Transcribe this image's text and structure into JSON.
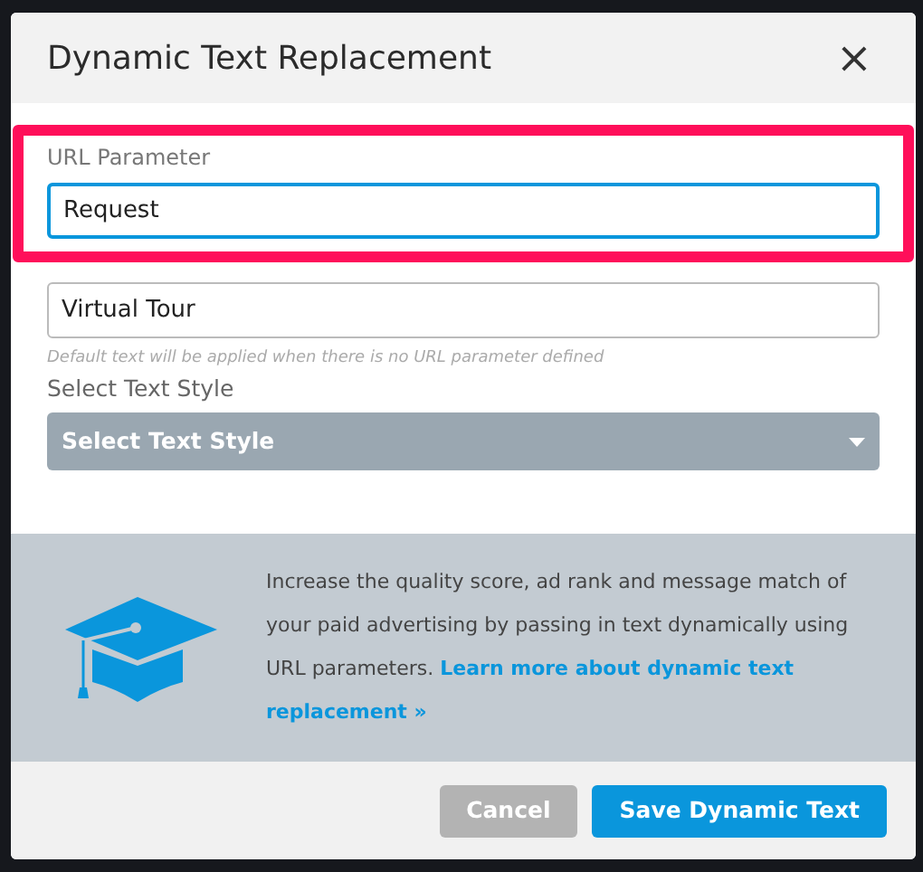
{
  "dialog": {
    "title": "Dynamic Text Replacement",
    "close": "×"
  },
  "highlight": {
    "shown": true
  },
  "url_parameter": {
    "label": "URL Parameter",
    "value": "Request",
    "focused": true
  },
  "default_text": {
    "value": "Virtual Tour",
    "hint": "Default text will be applied when there is no URL parameter defined"
  },
  "text_style": {
    "label": "Select Text Style",
    "placeholder": "Select Text Style"
  },
  "info": {
    "text": "Increase the quality score, ad rank and message match of your paid advertising by passing in text dynamically using URL parameters. ",
    "link": [
      "Learn more about dynamic text",
      "replacement »"
    ]
  },
  "buttons": [
    {
      "label": "Cancel",
      "kind": "secondary"
    },
    {
      "label": "Save Dynamic Text",
      "kind": "primary"
    }
  ]
}
